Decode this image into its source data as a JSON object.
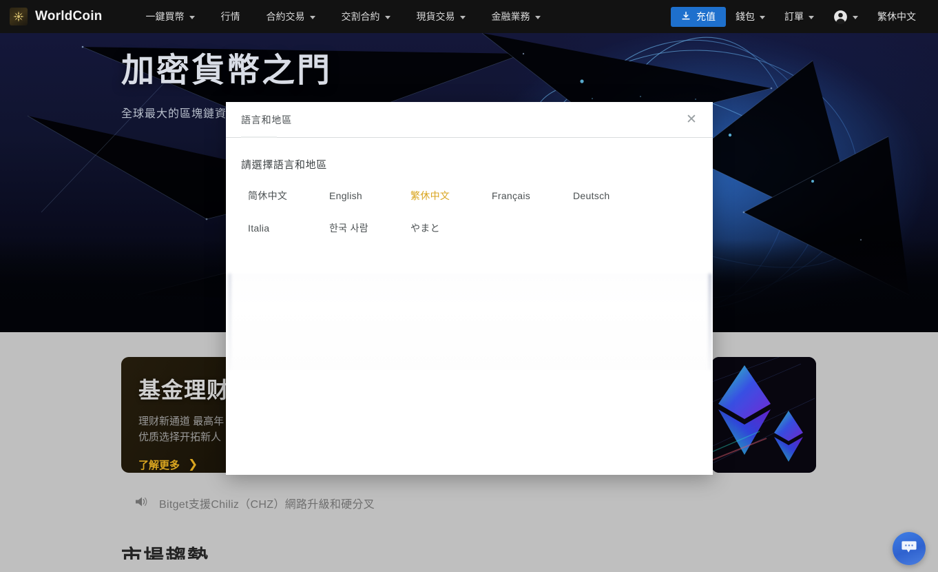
{
  "header": {
    "brand": {
      "name": "WorldCoin",
      "logo_icon": "worldcoin-logo-icon"
    },
    "nav": [
      {
        "label": "一鍵買幣",
        "has_caret": true
      },
      {
        "label": "行情",
        "has_caret": false
      },
      {
        "label": "合約交易",
        "has_caret": true
      },
      {
        "label": "交割合約",
        "has_caret": true
      },
      {
        "label": "現貨交易",
        "has_caret": true
      },
      {
        "label": "金融業務",
        "has_caret": true
      }
    ],
    "deposit_button": {
      "label": "充值",
      "icon": "download-icon",
      "color": "#1e70cd"
    },
    "wallet": {
      "label": "錢包",
      "has_caret": true
    },
    "orders": {
      "label": "訂單",
      "has_caret": true
    },
    "account": {
      "icon": "user-avatar-icon",
      "has_caret": true
    },
    "language": {
      "label": "繁休中文"
    }
  },
  "hero": {
    "title": "加密貨幣之門",
    "subtitle": "全球最大的區塊鏈資產"
  },
  "promo": {
    "title": "基金理财",
    "desc_line1": "理财新通道 最高年",
    "desc_line2": "优质选择开拓新人",
    "cta_label": "了解更多",
    "cta_chevron": "❯",
    "accent": "#d9a520"
  },
  "eth_card": {
    "image_name": "ethereum-diamond-graphic"
  },
  "news": {
    "icon": "speaker-announcement-icon",
    "text": "Bitget支援Chiliz（CHZ）網路升級和硬分叉"
  },
  "section_heading": "市場趨勢",
  "chat": {
    "icon": "chat-bubble-icon"
  },
  "modal": {
    "title": "語言和地區",
    "close_icon": "close-icon",
    "close_glyph": "✕",
    "choose_label": "請選擇語言和地區",
    "selected_language": "繁休中文",
    "active_color": "#d9a520",
    "languages": [
      "简休中文",
      "English",
      "繁休中文",
      "Français",
      "Deutsch",
      "Italia",
      "한국 사람",
      "やまと"
    ]
  }
}
